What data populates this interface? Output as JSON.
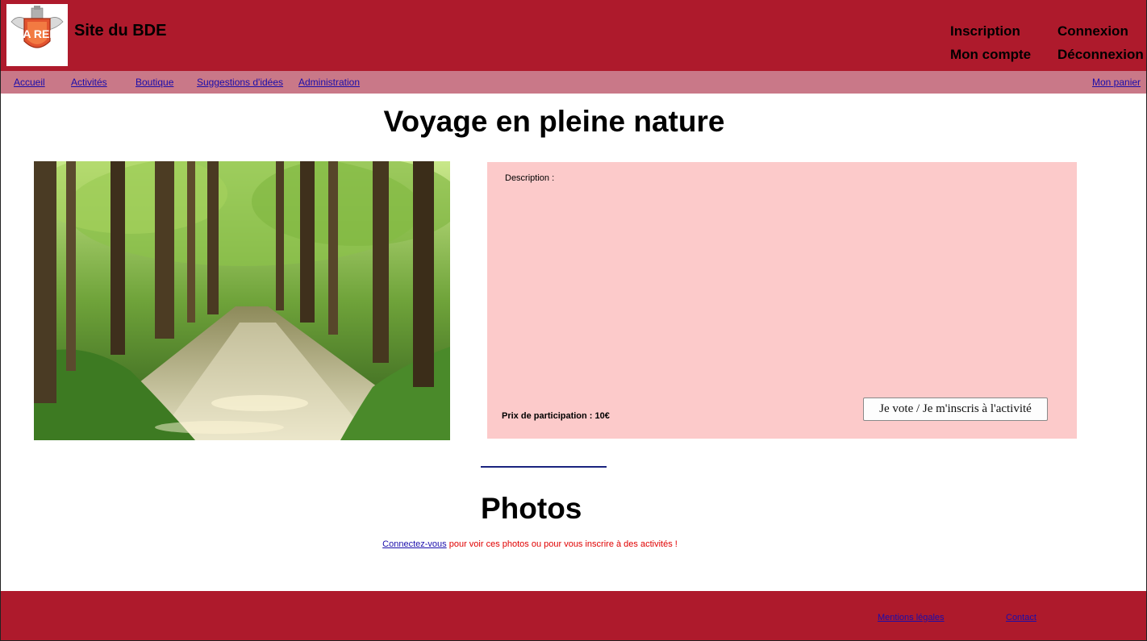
{
  "header": {
    "logo_alt": "EXIA REIMS",
    "site_title": "Site du BDE",
    "links": {
      "inscription": "Inscription",
      "connexion": "Connexion",
      "mon_compte": "Mon compte",
      "deconnexion": "Déconnexion"
    }
  },
  "nav": {
    "items": [
      "Accueil",
      "Activités",
      "Boutique",
      "Suggestions d'idées",
      "Administration"
    ],
    "cart": "Mon panier"
  },
  "activity": {
    "title": "Voyage en pleine nature",
    "description_label": "Description :",
    "price_label": "Prix de participation : 10€",
    "vote_button": "Je vote / Je m'inscris à l'activité"
  },
  "photos": {
    "title": "Photos",
    "login_link": "Connectez-vous",
    "login_message": " pour voir ces photos ou pour vous inscrire à des activités !"
  },
  "footer": {
    "mentions": "Mentions légales",
    "contact": "Contact"
  },
  "colors": {
    "header_bg": "#ae1a2c",
    "nav_bg": "#c97888",
    "panel_bg": "#fccaca",
    "link": "#1a0dab",
    "warning_text": "#e00000"
  }
}
